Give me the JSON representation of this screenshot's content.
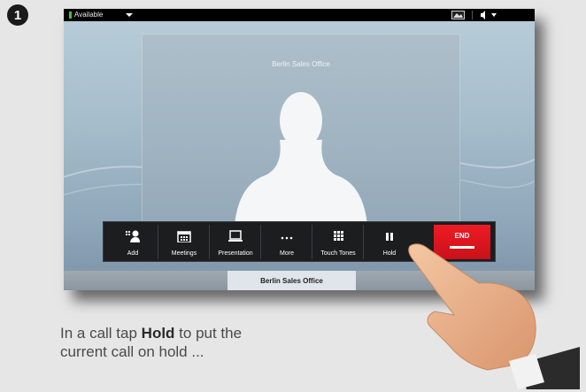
{
  "step": {
    "number": "1"
  },
  "statusbar": {
    "availability": "Available",
    "icons": [
      "selfview-icon",
      "volume-icon",
      "chevron-down-icon"
    ]
  },
  "video": {
    "remote_name": "Berlin Sales Office"
  },
  "toolbar": {
    "buttons": [
      {
        "label": "Add",
        "icon": "add-participant-icon"
      },
      {
        "label": "Meetings",
        "icon": "calendar-icon"
      },
      {
        "label": "Presentation",
        "icon": "laptop-icon"
      },
      {
        "label": "More",
        "icon": "ellipsis-icon"
      },
      {
        "label": "Touch Tones",
        "icon": "keypad-icon"
      },
      {
        "label": "Hold",
        "icon": "pause-icon"
      }
    ],
    "end_label": "END"
  },
  "callbar": {
    "active_call": "Berlin Sales Office"
  },
  "caption": {
    "before": "In a call tap ",
    "bold": "Hold",
    "after": " to put the current call on hold ..."
  },
  "colors": {
    "end_button": "#ee1b24",
    "status_available": "#3fc23f",
    "toolbar_bg": "#1c1d1f"
  }
}
